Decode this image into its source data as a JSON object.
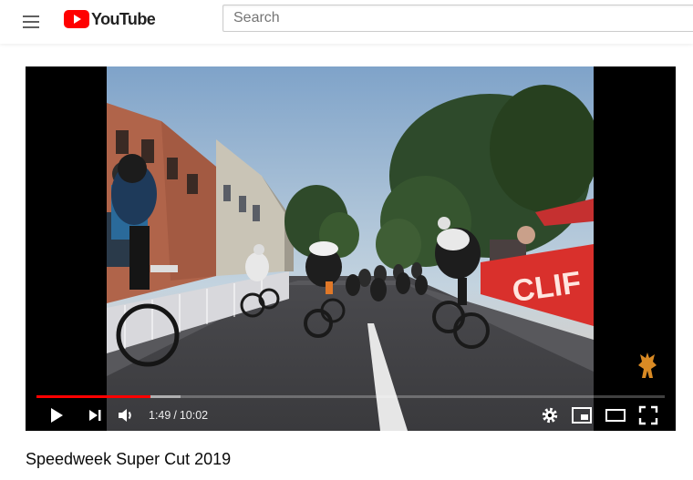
{
  "header": {
    "logo_text": "YouTube",
    "search_placeholder": "Search"
  },
  "player": {
    "current_time": "1:49",
    "duration": "10:02",
    "time_separator": "/",
    "played_fraction": 0.181,
    "loaded_fraction": 0.23,
    "banner_text": "CLIF"
  },
  "video_title": "Speedweek Super Cut 2019",
  "colors": {
    "brand_red": "#ff0000",
    "text": "#0a0a0a"
  },
  "icons": [
    "menu-icon",
    "youtube-logo-icon",
    "play-icon",
    "next-icon",
    "volume-icon",
    "settings-icon",
    "miniplayer-icon",
    "theater-mode-icon",
    "fullscreen-icon",
    "fox-watermark-icon"
  ]
}
